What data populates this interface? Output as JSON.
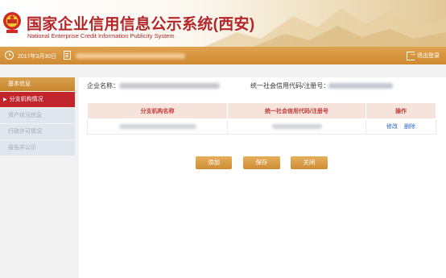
{
  "header": {
    "title_cn": "国家企业信用信息公示系统(西安)",
    "title_en": "National Enterprise Credit Information Publicity System"
  },
  "topbar": {
    "date": "2017年3月30日",
    "logout_label": "退出登录"
  },
  "sidebar": {
    "section_title": "基本信息",
    "items": [
      {
        "label": "分支机构情况",
        "active": true
      },
      {
        "label": "资产状况信息",
        "active": false
      },
      {
        "label": "行政许可情况",
        "active": false
      },
      {
        "label": "报告并公示",
        "active": false
      }
    ]
  },
  "info": {
    "company_label": "企业名称：",
    "reg_label": "统一社会信用代码/注册号："
  },
  "table": {
    "headers": [
      "分支机构名称",
      "统一社会信用代码/注册号",
      "操作"
    ],
    "rows": [
      {
        "ops": [
          "修改",
          "删除"
        ]
      }
    ]
  },
  "buttons": {
    "add": "添加",
    "save": "保存",
    "close": "关闭"
  },
  "colors": {
    "brand_red": "#b4262a",
    "accent_orange": "#cf8a32",
    "link_blue": "#2f63c3"
  }
}
